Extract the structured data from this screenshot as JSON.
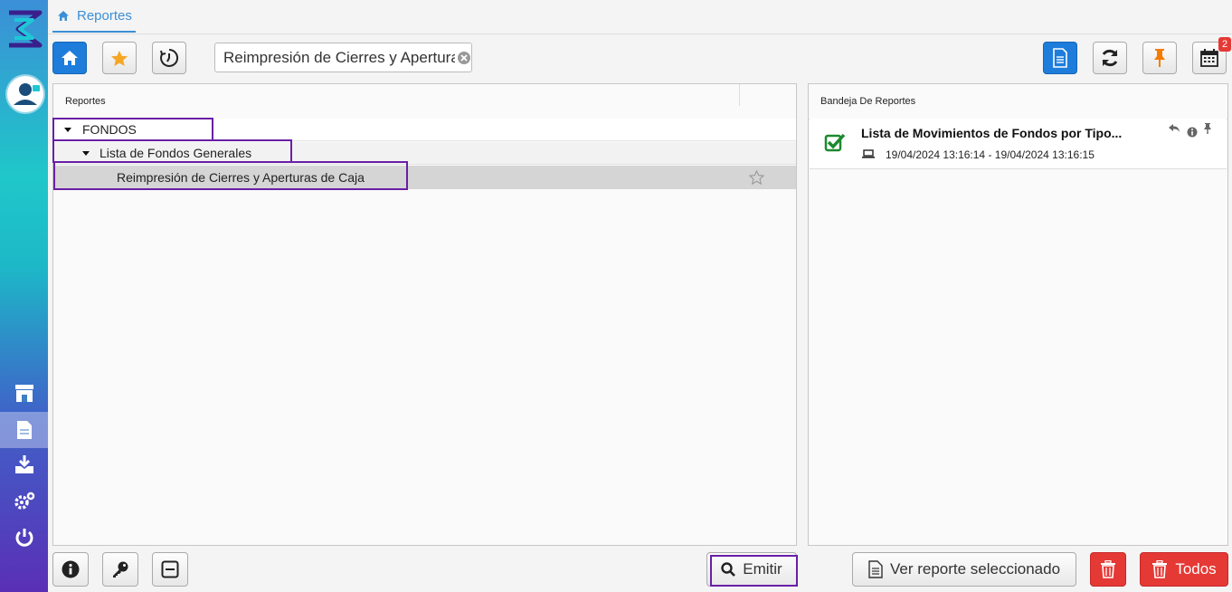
{
  "breadcrumb": {
    "label": "Reportes"
  },
  "search": {
    "value": "Reimpresión de Cierres y Apertura"
  },
  "toolbar": {
    "calendar_badge": "2"
  },
  "reports_panel": {
    "header": "Reportes",
    "tree": [
      {
        "label": "FONDOS",
        "level": 0
      },
      {
        "label": "Lista de Fondos Generales",
        "level": 1
      },
      {
        "label": "Reimpresión de Cierres y Aperturas de Caja",
        "level": 2,
        "selected": true
      }
    ]
  },
  "tray_panel": {
    "header": "Bandeja De Reportes",
    "items": [
      {
        "title": "Lista de Movimientos de Fondos por Tipo...",
        "dates": "19/04/2024 13:16:14 - 19/04/2024 13:16:15"
      }
    ]
  },
  "buttons": {
    "emit": "Emitir",
    "view_selected": "Ver reporte seleccionado",
    "all": "Todos"
  },
  "colors": {
    "accent": "#1e7ddb",
    "danger": "#e53935",
    "highlight": "#6a1fa6",
    "star": "#f5a623"
  }
}
